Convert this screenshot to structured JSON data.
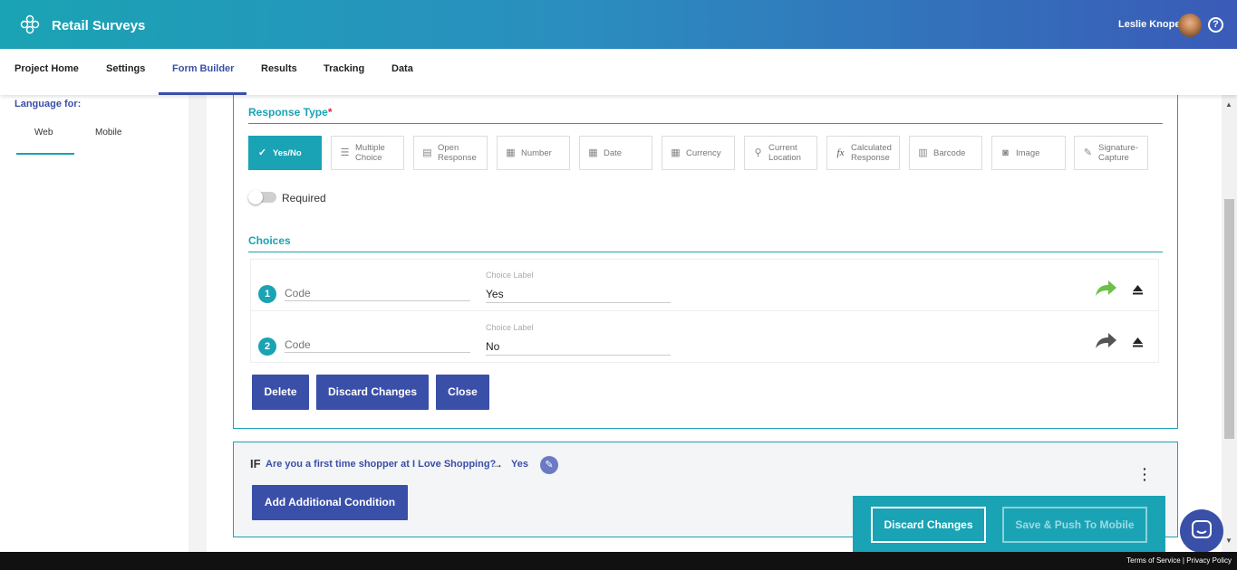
{
  "header": {
    "app_title": "Retail Surveys",
    "user_name": "Leslie Knope",
    "help_glyph": "?",
    "logo_icon": "flower-logo-icon"
  },
  "nav": {
    "tabs": [
      {
        "label": "Project Home",
        "active": false
      },
      {
        "label": "Settings",
        "active": false
      },
      {
        "label": "Form Builder",
        "active": true
      },
      {
        "label": "Results",
        "active": false
      },
      {
        "label": "Tracking",
        "active": false
      },
      {
        "label": "Data",
        "active": false
      }
    ]
  },
  "sidebar": {
    "language_label": "Language for:",
    "tabs": [
      {
        "label": "Web",
        "active": true
      },
      {
        "label": "Mobile",
        "active": false
      }
    ]
  },
  "editor": {
    "response_type_title": "Response Type",
    "required_marker": "*",
    "response_types": [
      {
        "label": "Yes/No",
        "icon": "check-x-icon",
        "active": true
      },
      {
        "label": "Multiple Choice",
        "icon": "list-icon",
        "active": false
      },
      {
        "label": "Open Response",
        "icon": "text-box-icon",
        "active": false
      },
      {
        "label": "Number",
        "icon": "calculator-icon",
        "active": false
      },
      {
        "label": "Date",
        "icon": "calendar-icon",
        "active": false
      },
      {
        "label": "Currency",
        "icon": "calculator-icon",
        "active": false
      },
      {
        "label": "Current Location",
        "icon": "location-pin-icon",
        "active": false
      },
      {
        "label": "Calculated Response",
        "icon": "function-icon",
        "active": false
      },
      {
        "label": "Barcode",
        "icon": "barcode-icon",
        "active": false
      },
      {
        "label": "Image",
        "icon": "camera-icon",
        "active": false
      },
      {
        "label": "Signature-Capture",
        "icon": "pen-icon",
        "active": false
      }
    ],
    "required_label": "Required",
    "required_on": false,
    "choices_title": "Choices",
    "choices": [
      {
        "number": "1",
        "code_placeholder": "Code",
        "label_caption": "Choice Label",
        "label_value": "Yes",
        "branch_color": "#6cc04a"
      },
      {
        "number": "2",
        "code_placeholder": "Code",
        "label_caption": "Choice Label",
        "label_value": "No",
        "branch_color": "#555555"
      }
    ],
    "buttons": {
      "delete": "Delete",
      "discard": "Discard Changes",
      "close": "Close"
    }
  },
  "condition": {
    "if_label": "IF",
    "question": "Are you a first time shopper at I Love Shopping?",
    "arrow": "→",
    "answer": "Yes",
    "add_button": "Add Additional Condition"
  },
  "save_panel": {
    "discard": "Discard Changes",
    "save_push": "Save & Push To Mobile"
  },
  "footer": {
    "terms": "Terms of Service",
    "separator": "|",
    "privacy": "Privacy Policy"
  },
  "colors": {
    "accent_teal": "#1aa3b4",
    "accent_blue": "#3a4fa8"
  }
}
